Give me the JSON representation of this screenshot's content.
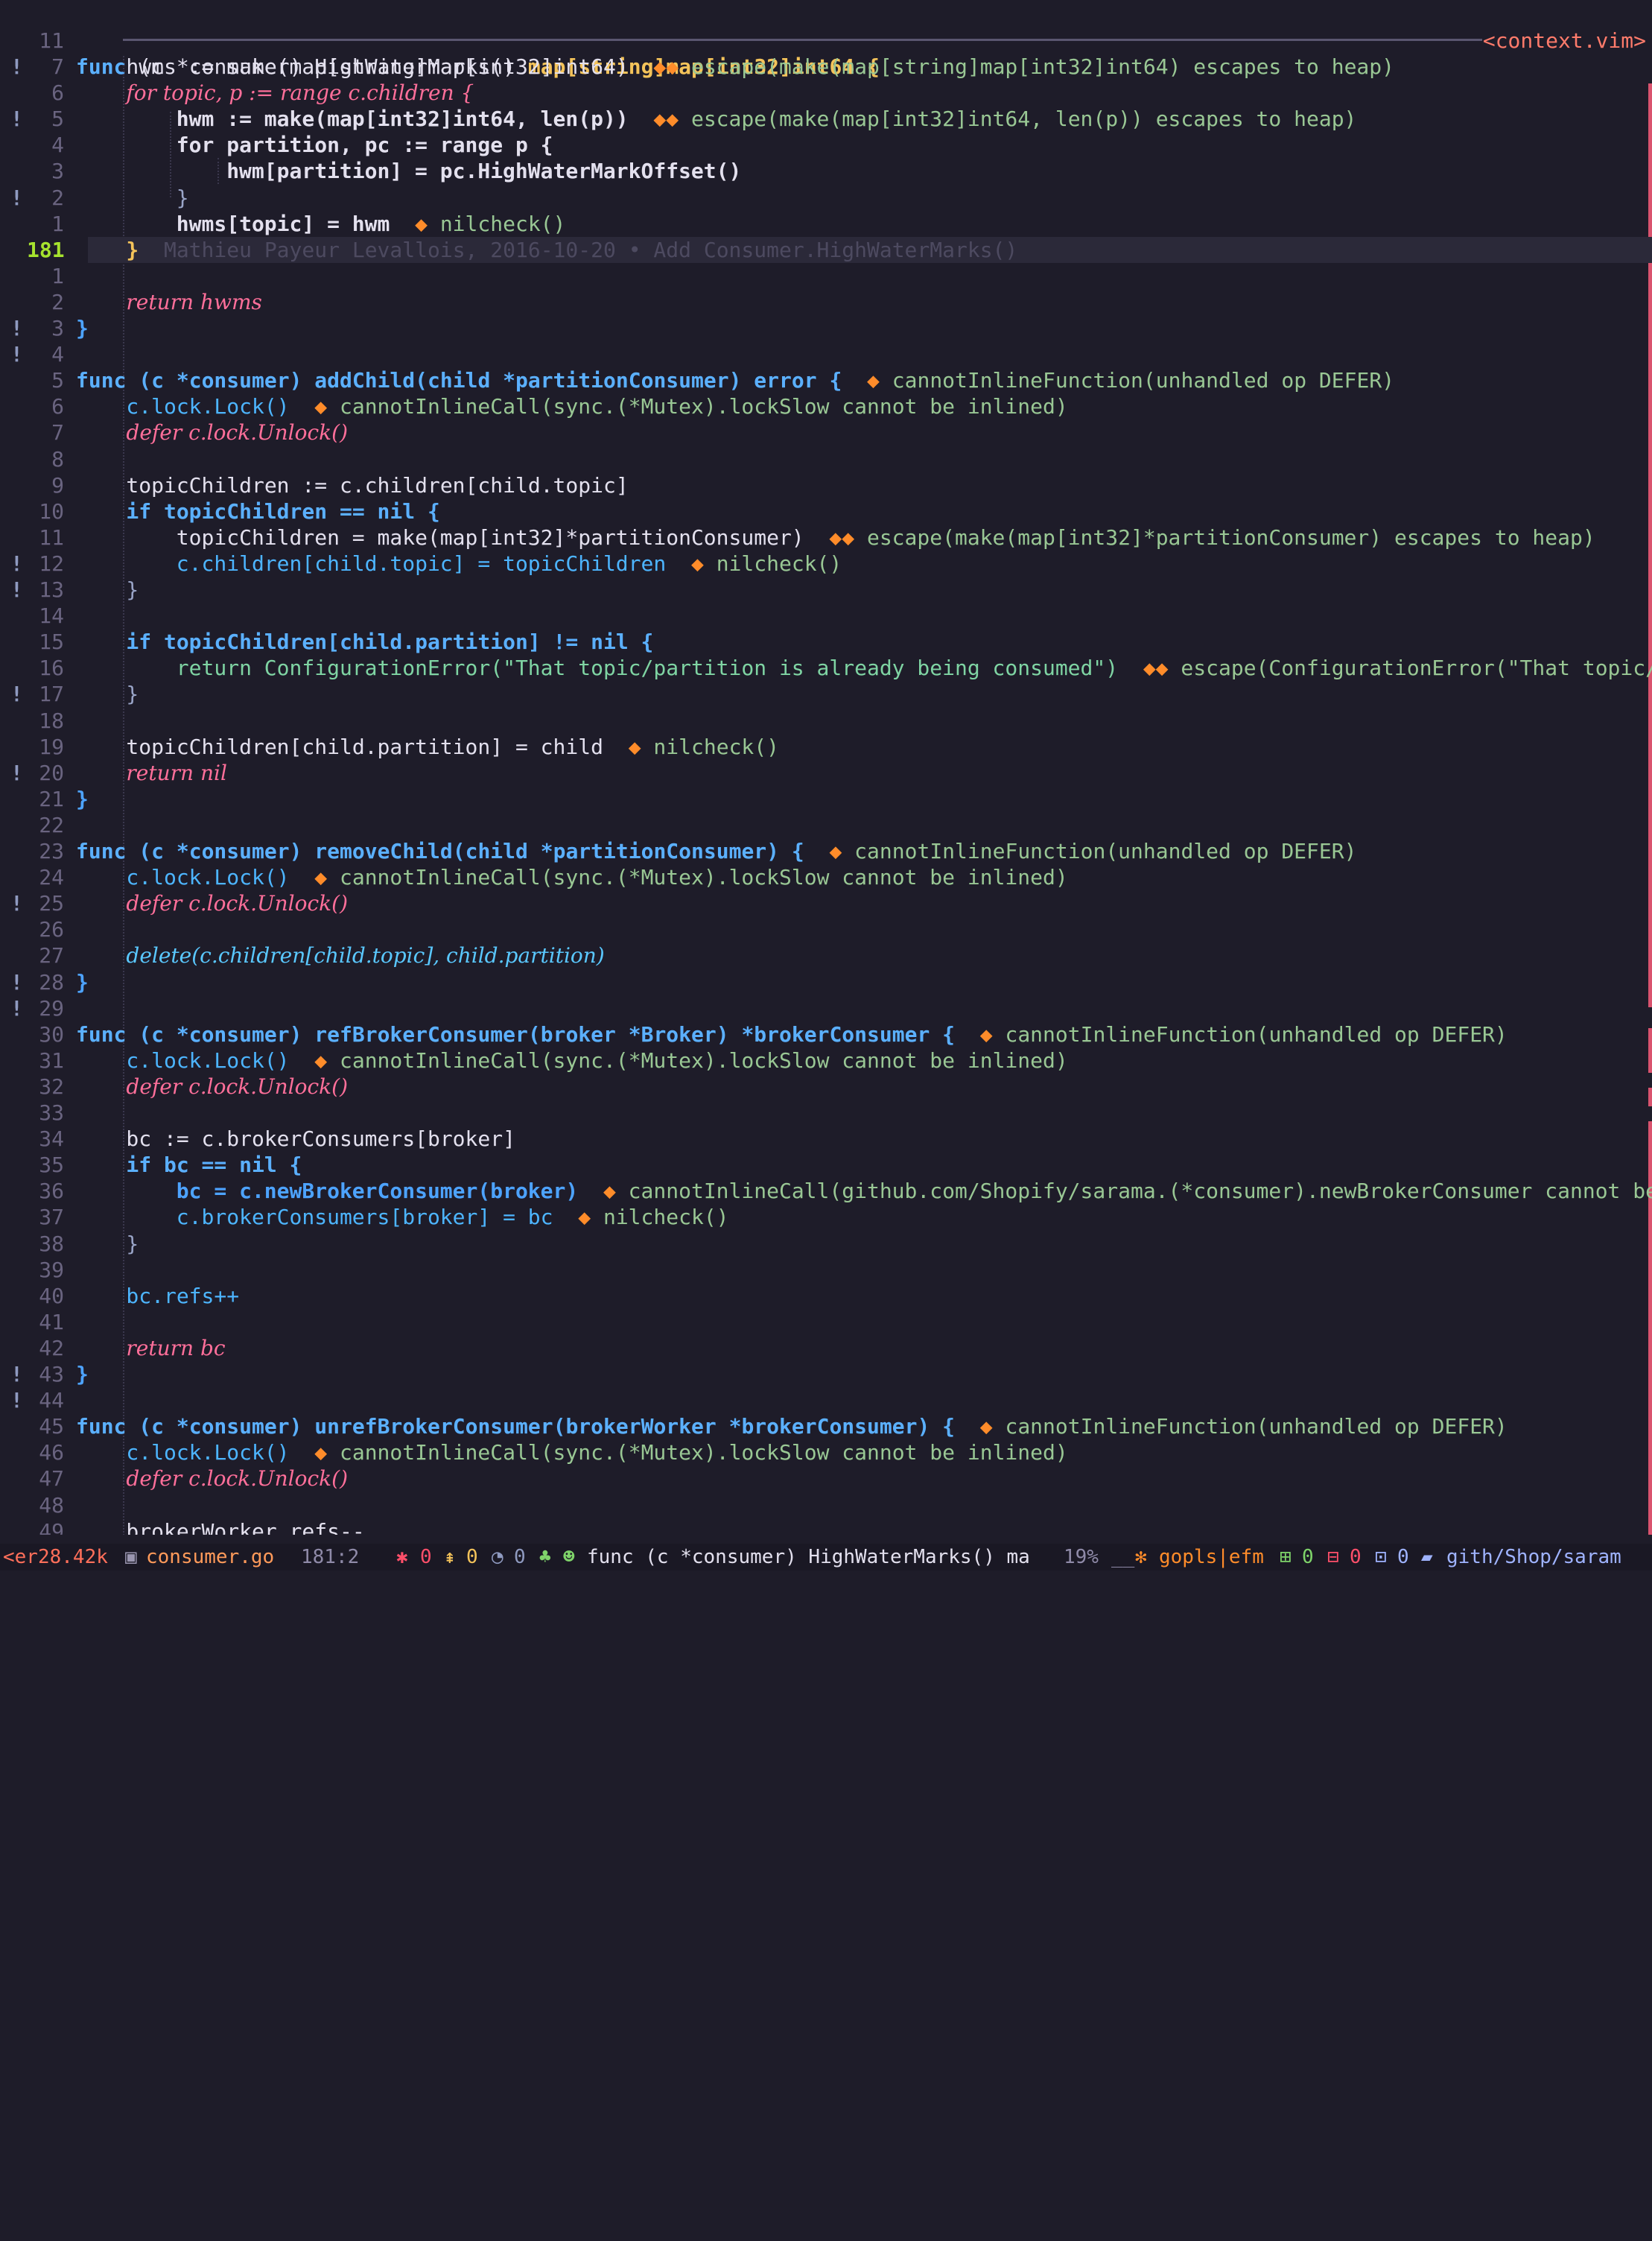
{
  "context": {
    "line_number": "11",
    "label": "<context.vim>"
  },
  "blame": "Mathieu Payeur Levallois, 2016-10-20 • Add Consumer.HighWaterMarks()",
  "gutter": {
    "signs": [
      "!",
      "",
      "!",
      "",
      "",
      "!",
      "",
      "",
      "",
      "",
      "!",
      "!",
      "",
      "",
      "",
      "",
      "",
      "",
      "",
      "!",
      "!",
      "",
      "",
      "",
      "!",
      "",
      "",
      "!",
      "",
      "",
      "",
      "",
      "!",
      "",
      "",
      "!",
      "!",
      "",
      "",
      "",
      "",
      "",
      "",
      "",
      "",
      "",
      "",
      "",
      "",
      "",
      "!",
      "!",
      "",
      "",
      "",
      "",
      "",
      "",
      ""
    ],
    "numbers": [
      "7",
      "6",
      "5",
      "4",
      "3",
      "2",
      "1",
      "181",
      "1",
      "2",
      "3",
      "4",
      "5",
      "6",
      "7",
      "8",
      "9",
      "10",
      "11",
      "12",
      "13",
      "14",
      "15",
      "16",
      "17",
      "18",
      "19",
      "20",
      "21",
      "22",
      "23",
      "24",
      "25",
      "26",
      "27",
      "28",
      "29",
      "30",
      "31",
      "32",
      "33",
      "34",
      "35",
      "36",
      "37",
      "38",
      "39",
      "40",
      "41",
      "42",
      "43",
      "44",
      "45",
      "46",
      "47",
      "48",
      "49"
    ]
  },
  "code": {
    "l_ctx_func": "func",
    "l_ctx_recv": "(c *consumer) HighWaterMarks()",
    "l_ctx_ret": "map[string]map[int32]int64 {",
    "l7": "hwms := make(map[string]map[int32]int64)",
    "l7_hint": "escape(make(map[string]map[int32]int64) escapes to heap)",
    "l6": "for topic, p := range c.children {",
    "l5": "hwm := make(map[int32]int64, len(p))",
    "l5_hint": "escape(make(map[int32]int64, len(p)) escapes to heap)",
    "l4": "for partition, pc := range p {",
    "l3": "hwm[partition] = pc.HighWaterMarkOffset()",
    "l2": "}",
    "l1": "hwms[topic] = hwm",
    "l1_hint": "nilcheck()",
    "l181": "}",
    "r2": "return hwms",
    "r3": "}",
    "r5": "func (c *consumer) addChild(child *partitionConsumer) error {",
    "r5_hint": "cannotInlineFunction(unhandled op DEFER)",
    "r6": "c.lock.Lock()",
    "r6_hint": "cannotInlineCall(sync.(*Mutex).lockSlow cannot be inlined)",
    "r7": "defer c.lock.Unlock()",
    "r9": "topicChildren := c.children[child.topic]",
    "r10": "if topicChildren == nil {",
    "r11": "topicChildren = make(map[int32]*partitionConsumer)",
    "r11_hint": "escape(make(map[int32]*partitionConsumer) escapes to heap)",
    "r12": "c.children[child.topic] = topicChildren",
    "r12_hint": "nilcheck()",
    "r13": "}",
    "r15": "if topicChildren[child.partition] != nil {",
    "r16": "return ConfigurationError(\"That topic/partition is already being consumed\")",
    "r16_hint": "escape(ConfigurationError(\"That topic/part",
    "r17": "}",
    "r19": "topicChildren[child.partition] = child",
    "r19_hint": "nilcheck()",
    "r20": "return nil",
    "r21": "}",
    "r23": "func (c *consumer) removeChild(child *partitionConsumer) {",
    "r23_hint": "cannotInlineFunction(unhandled op DEFER)",
    "r24": "c.lock.Lock()",
    "r24_hint": "cannotInlineCall(sync.(*Mutex).lockSlow cannot be inlined)",
    "r25": "defer c.lock.Unlock()",
    "r27": "delete(c.children[child.topic], child.partition)",
    "r28": "}",
    "r30": "func (c *consumer) refBrokerConsumer(broker *Broker) *brokerConsumer {",
    "r30_hint": "cannotInlineFunction(unhandled op DEFER)",
    "r31": "c.lock.Lock()",
    "r31_hint": "cannotInlineCall(sync.(*Mutex).lockSlow cannot be inlined)",
    "r32": "defer c.lock.Unlock()",
    "r34": "bc := c.brokerConsumers[broker]",
    "r35": "if bc == nil {",
    "r36": "bc = c.newBrokerConsumer(broker)",
    "r36_hint": "cannotInlineCall(github.com/Shopify/sarama.(*consumer).newBrokerConsumer cannot be inli",
    "r37": "c.brokerConsumers[broker] = bc",
    "r37_hint": "nilcheck()",
    "r38": "}",
    "r40": "bc.refs++",
    "r42": "return bc",
    "r43": "}",
    "r45": "func (c *consumer) unrefBrokerConsumer(brokerWorker *brokerConsumer) {",
    "r45_hint": "cannotInlineFunction(unhandled op DEFER)",
    "r46": "c.lock.Lock()",
    "r46_hint": "cannotInlineCall(sync.(*Mutex).lockSlow cannot be inlined)",
    "r47": "defer c.lock.Unlock()",
    "r49": "brokerWorker.refs--"
  },
  "statusline": {
    "filesize": "<er28.42k",
    "filename": "consumer.go",
    "position": "181:2",
    "bugs": "0",
    "warnings": "0",
    "hints": "0",
    "func_ctx": "func (c *consumer) HighWaterMarks() ma",
    "percent": "19%",
    "lsp": "gopls|efm",
    "added": "0",
    "removed": "0",
    "changed": "0",
    "path": "gith/Shop/saram"
  },
  "colors": {
    "background": "#1e1c29",
    "keyword": "#5bb0ff",
    "hint": "#99c794",
    "diff_marker": "#d9536e",
    "current_line_number": "#a6e22e"
  }
}
